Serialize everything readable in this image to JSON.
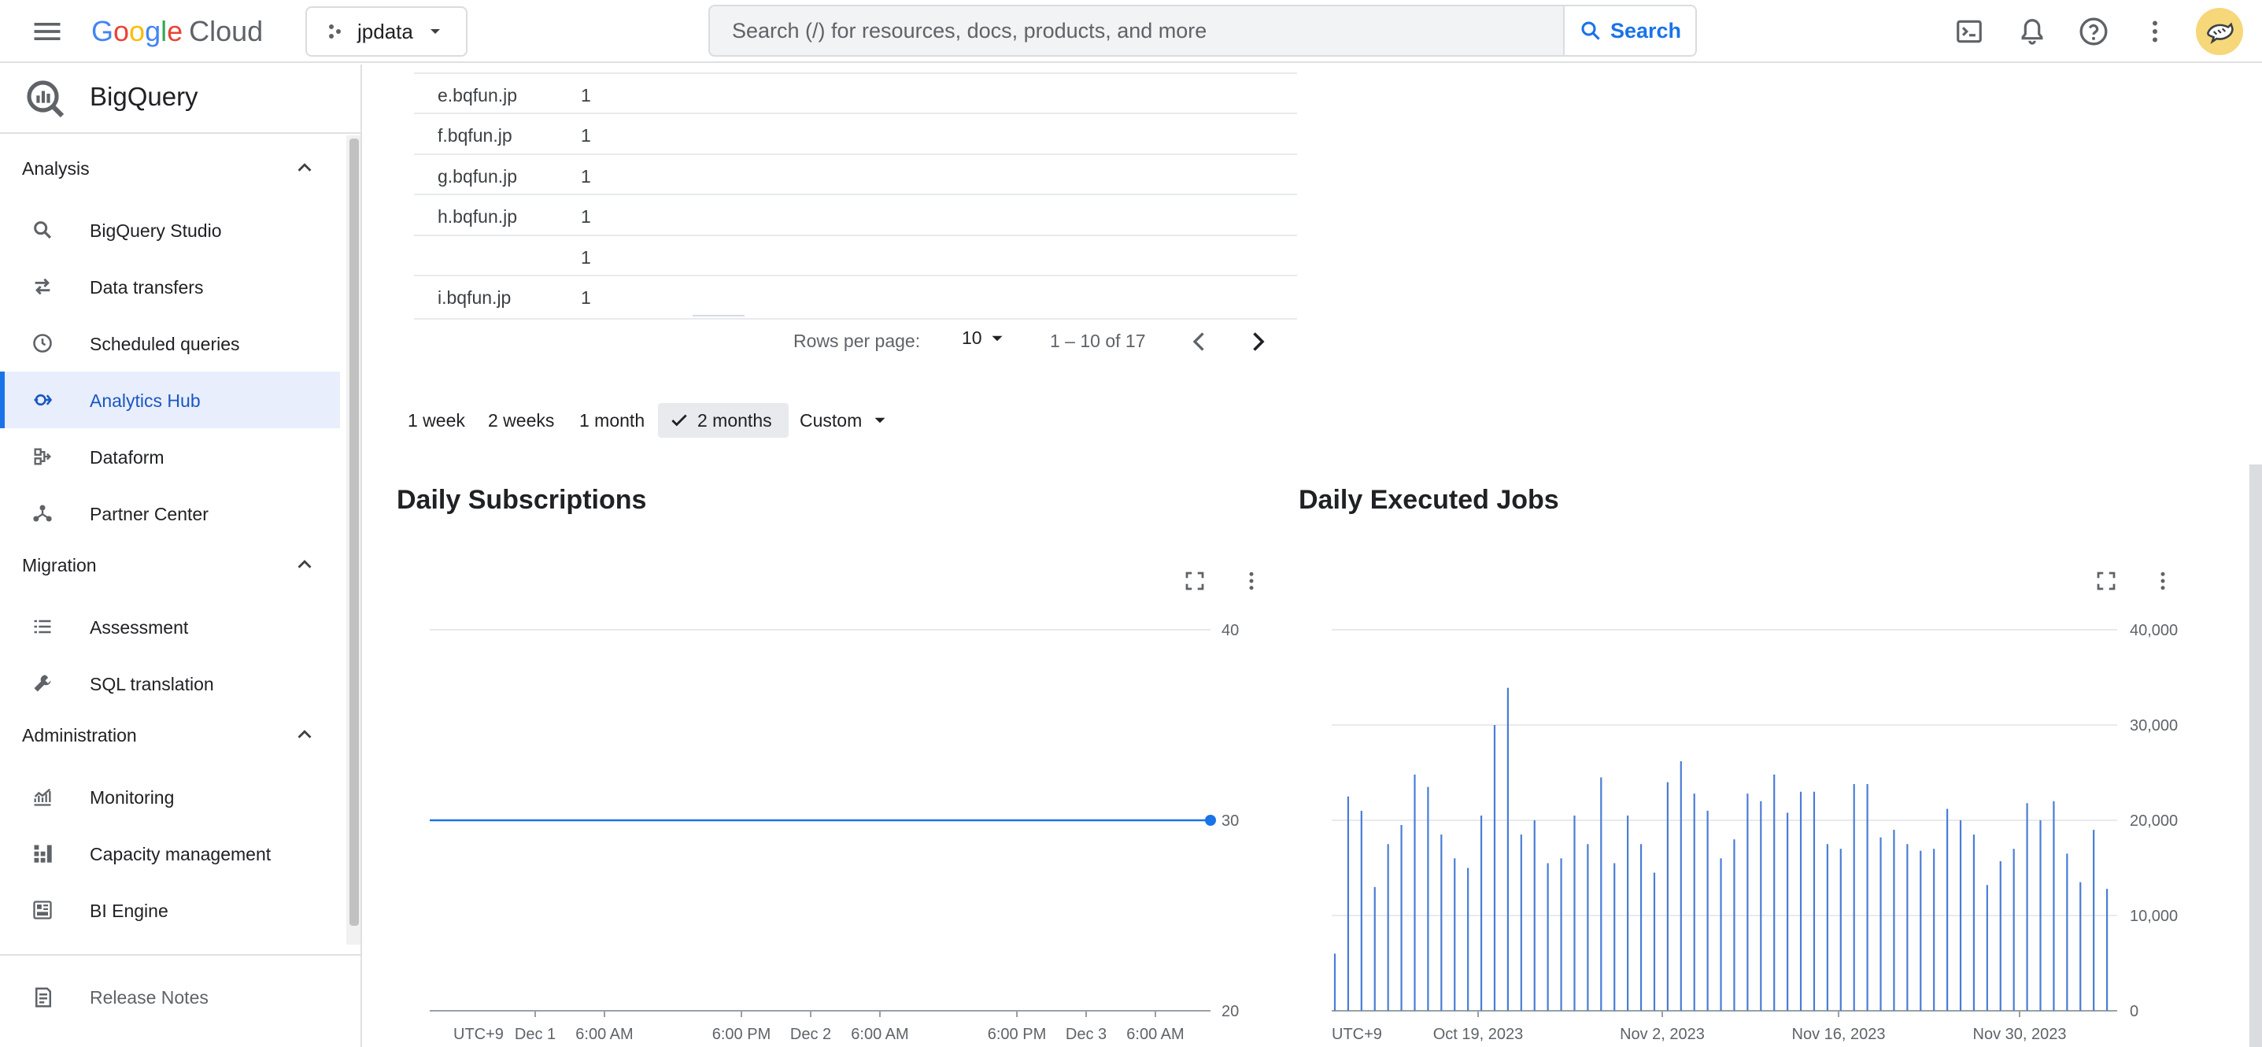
{
  "header": {
    "product_brand": {
      "g1": "G",
      "g2": "o",
      "g3": "o",
      "g4": "g",
      "g5": "l",
      "g6": "e",
      "cloud": "Cloud"
    },
    "project": "jpdata",
    "search_placeholder": "Search (/) for resources, docs, products, and more",
    "search_button": "Search",
    "icons": [
      "menu-icon",
      "project-icon",
      "dropdown-icon",
      "search-icon",
      "terminal-icon",
      "bell-icon",
      "help-icon",
      "more-vert-icon",
      "avatar"
    ]
  },
  "sidebar": {
    "product": "BigQuery",
    "sections": [
      {
        "label": "Analysis",
        "items": [
          {
            "label": "BigQuery Studio",
            "icon": "search-icon"
          },
          {
            "label": "Data transfers",
            "icon": "transfer-icon"
          },
          {
            "label": "Scheduled queries",
            "icon": "clock-icon"
          },
          {
            "label": "Analytics Hub",
            "icon": "analytics-hub-icon",
            "active": true
          },
          {
            "label": "Dataform",
            "icon": "dataform-icon"
          },
          {
            "label": "Partner Center",
            "icon": "partner-icon"
          }
        ]
      },
      {
        "label": "Migration",
        "items": [
          {
            "label": "Assessment",
            "icon": "list-icon"
          },
          {
            "label": "SQL translation",
            "icon": "wrench-icon"
          }
        ]
      },
      {
        "label": "Administration",
        "items": [
          {
            "label": "Monitoring",
            "icon": "monitoring-icon"
          },
          {
            "label": "Capacity management",
            "icon": "capacity-icon"
          },
          {
            "label": "BI Engine",
            "icon": "bi-engine-icon"
          }
        ]
      }
    ],
    "release_notes": "Release Notes"
  },
  "table": {
    "rows": [
      {
        "name": "e.bqfun.jp",
        "count": "1"
      },
      {
        "name": "f.bqfun.jp",
        "count": "1"
      },
      {
        "name": "g.bqfun.jp",
        "count": "1"
      },
      {
        "name": "h.bqfun.jp",
        "count": "1"
      },
      {
        "name": "",
        "count": "1"
      },
      {
        "name": "i.bqfun.jp",
        "count": "1"
      }
    ],
    "pager": {
      "rows_per_page_label": "Rows per page:",
      "rows_per_page": "10",
      "range": "1 – 10 of 17"
    }
  },
  "range_chips": [
    "1 week",
    "2 weeks",
    "1 month",
    "2 months",
    "Custom"
  ],
  "selected_range": "2 months",
  "colors": {
    "accent": "#1a73e8",
    "series": "#4a7cd6",
    "grid": "#e8eaed"
  },
  "chart_data": [
    {
      "type": "line",
      "title": "Daily Subscriptions",
      "x_tick_labels": [
        "UTC+9",
        "Dec 1",
        "6:00 AM",
        "6:00 PM",
        "Dec 2",
        "6:00 AM",
        "6:00 PM",
        "Dec 3",
        "6:00 AM"
      ],
      "y_tick_labels": [
        "40",
        "30",
        "20"
      ],
      "ylim": [
        20,
        40
      ],
      "series": [
        {
          "values": [
            30,
            30,
            30,
            30,
            30,
            30,
            30,
            30,
            30,
            30
          ]
        }
      ],
      "grid": true
    },
    {
      "type": "bar",
      "title": "Daily Executed Jobs",
      "x_tick_labels": [
        "UTC+9",
        "Oct 19, 2023",
        "Nov 2, 2023",
        "Nov 16, 2023",
        "Nov 30, 2023"
      ],
      "y_tick_labels": [
        "40,000",
        "30,000",
        "20,000",
        "10,000",
        "0"
      ],
      "ylim": [
        0,
        40000
      ],
      "series": [
        {
          "values": [
            6000,
            22500,
            21000,
            13000,
            17500,
            19500,
            24800,
            23500,
            18500,
            16000,
            15000,
            20500,
            30000,
            33900,
            18500,
            20000,
            15500,
            16000,
            20500,
            17500,
            24500,
            15500,
            20500,
            17500,
            14500,
            24000,
            26200,
            22800,
            21000,
            16000,
            18000,
            22800,
            22000,
            24800,
            20800,
            23000,
            23000,
            17500,
            17000,
            23800,
            23800,
            18200,
            19000,
            17500,
            16800,
            17000,
            21200,
            20000,
            18500,
            13200,
            15700,
            17000,
            21800,
            20000,
            22000,
            16500,
            13500,
            19000,
            12800
          ]
        }
      ],
      "grid": true
    }
  ]
}
